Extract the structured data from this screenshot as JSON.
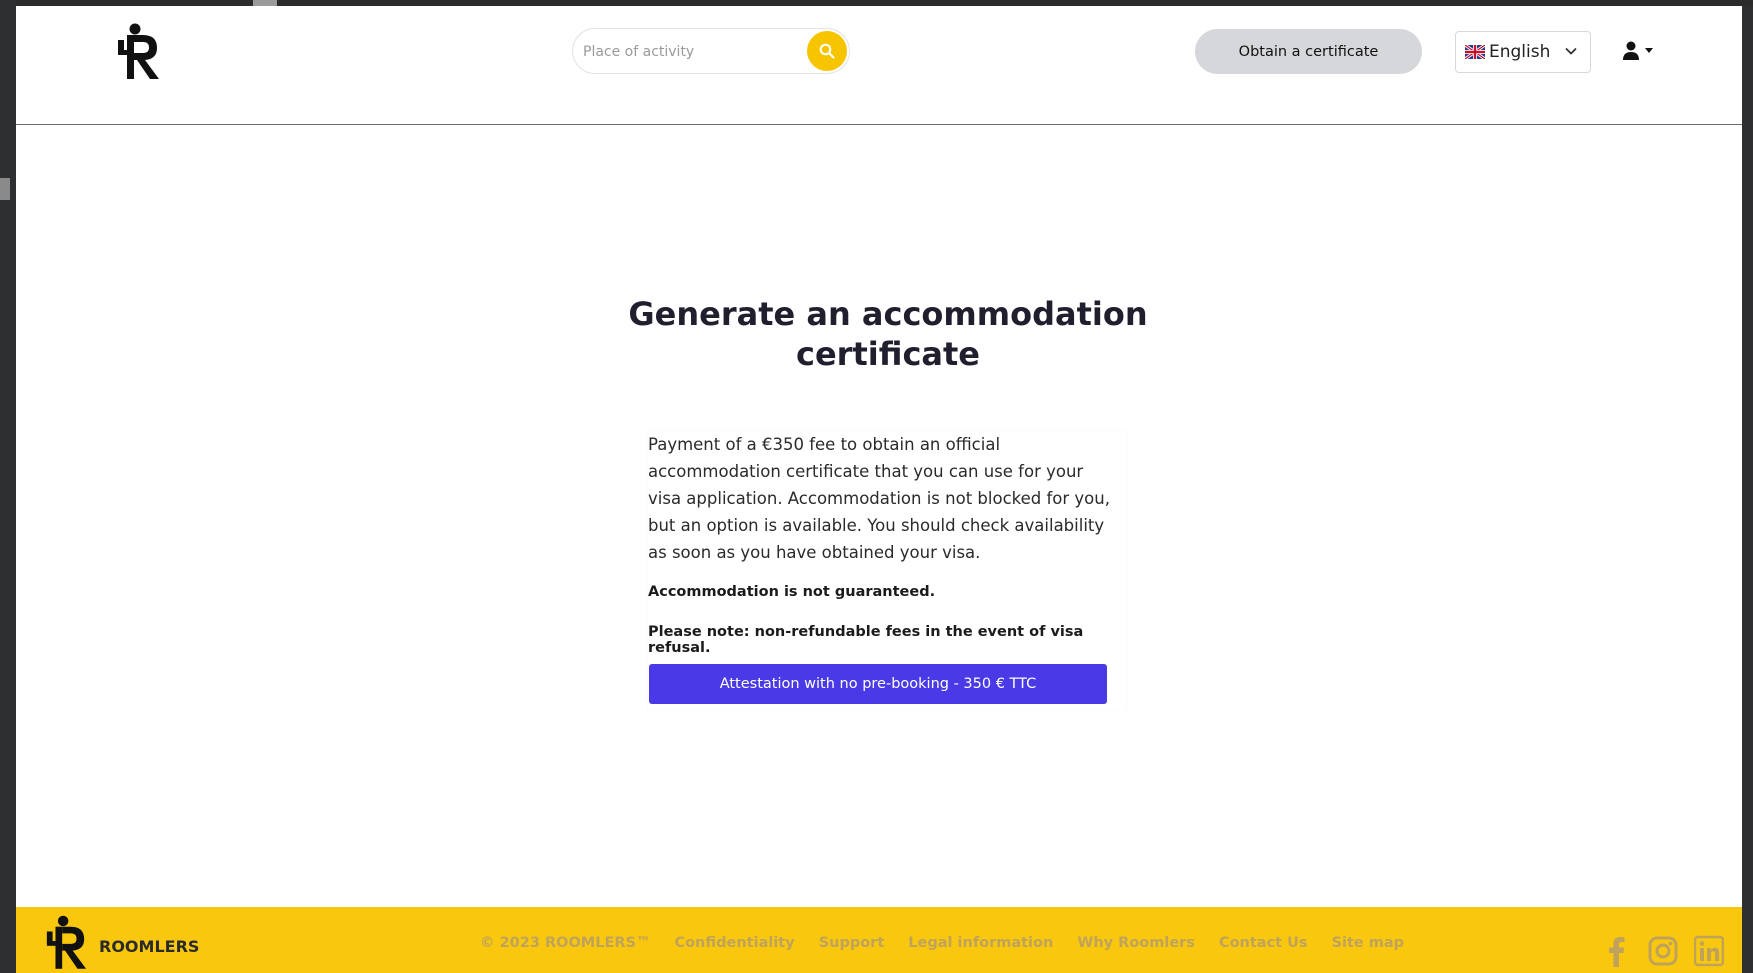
{
  "header": {
    "search_placeholder": "Place of activity",
    "certificate_button": "Obtain a certificate",
    "language": "English"
  },
  "main": {
    "title": "Generate an accommodation certificate",
    "description": "Payment of a €350 fee to obtain an official accommodation certificate that you can use for your visa application. Accommodation is not blocked for you, but an option is available. You should check availability as soon as you have obtained your visa.",
    "note_guarantee": "Accommodation is not guaranteed.",
    "note_refund": "Please note: non-refundable fees in the event of visa refusal.",
    "cta_label": "Attestation with no pre-booking - 350 € TTC"
  },
  "footer": {
    "brand": "ROOMLERS",
    "copyright": "© 2023 ROOMLERS™",
    "links": [
      "Confidentiality",
      "Support",
      "Legal information",
      "Why Roomlers",
      "Contact Us",
      "Site map"
    ]
  },
  "colors": {
    "accent_yellow": "#f9c80e",
    "cta_purple": "#4a39e6",
    "footer_link": "#bfa35a"
  },
  "icons": [
    "logo-icon",
    "search-icon",
    "uk-flag-icon",
    "chevron-down-icon",
    "user-icon",
    "caret-down-icon",
    "facebook-icon",
    "instagram-icon",
    "linkedin-icon"
  ]
}
